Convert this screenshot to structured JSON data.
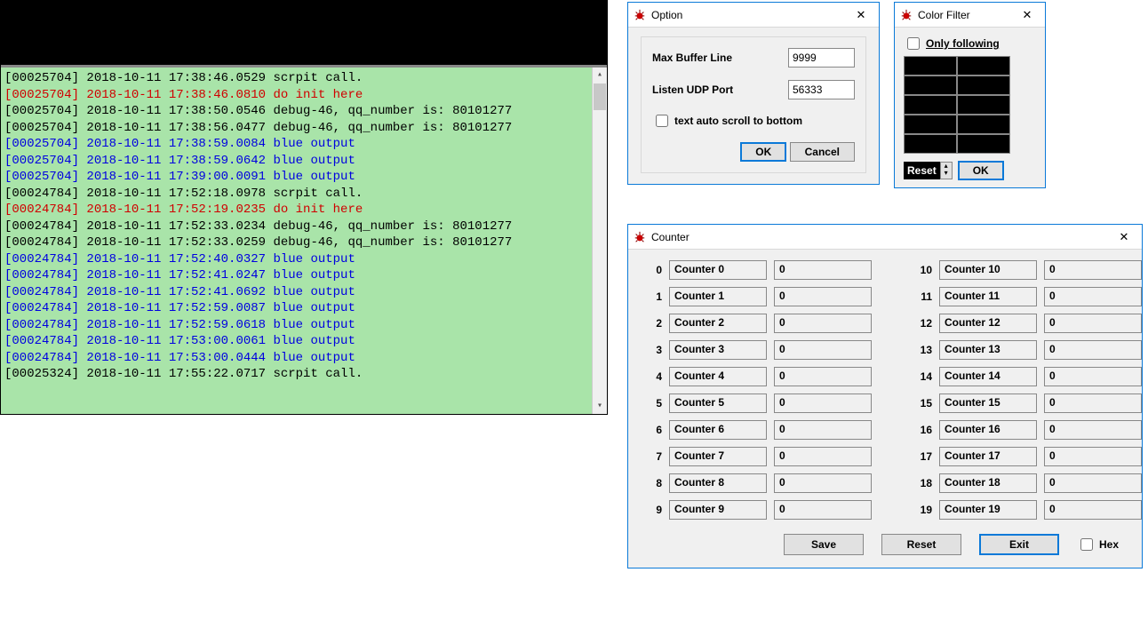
{
  "log": {
    "lines": [
      {
        "pid": "[00025704]",
        "ts": "2018-10-11 17:38:46.0529",
        "msg": "scrpit call.",
        "cls": "black"
      },
      {
        "pid": "[00025704]",
        "ts": "2018-10-11 17:38:46.0810",
        "msg": "do init here",
        "cls": "red"
      },
      {
        "pid": "[00025704]",
        "ts": "2018-10-11 17:38:50.0546",
        "msg": "debug-46, qq_number is: 80101277",
        "cls": "black"
      },
      {
        "pid": "[00025704]",
        "ts": "2018-10-11 17:38:56.0477",
        "msg": "debug-46, qq_number is: 80101277",
        "cls": "black"
      },
      {
        "pid": "[00025704]",
        "ts": "2018-10-11 17:38:59.0084",
        "msg": "blue output",
        "cls": "blue"
      },
      {
        "pid": "[00025704]",
        "ts": "2018-10-11 17:38:59.0642",
        "msg": "blue output",
        "cls": "blue"
      },
      {
        "pid": "[00025704]",
        "ts": "2018-10-11 17:39:00.0091",
        "msg": "blue output",
        "cls": "blue"
      },
      {
        "pid": "[00024784]",
        "ts": "2018-10-11 17:52:18.0978",
        "msg": "scrpit call.",
        "cls": "black"
      },
      {
        "pid": "[00024784]",
        "ts": "2018-10-11 17:52:19.0235",
        "msg": "do init here",
        "cls": "red"
      },
      {
        "pid": "[00024784]",
        "ts": "2018-10-11 17:52:33.0234",
        "msg": "debug-46, qq_number is: 80101277",
        "cls": "black"
      },
      {
        "pid": "[00024784]",
        "ts": "2018-10-11 17:52:33.0259",
        "msg": "debug-46, qq_number is: 80101277",
        "cls": "black"
      },
      {
        "pid": "[00024784]",
        "ts": "2018-10-11 17:52:40.0327",
        "msg": "blue output",
        "cls": "blue"
      },
      {
        "pid": "[00024784]",
        "ts": "2018-10-11 17:52:41.0247",
        "msg": "blue output",
        "cls": "blue"
      },
      {
        "pid": "[00024784]",
        "ts": "2018-10-11 17:52:41.0692",
        "msg": "blue output",
        "cls": "blue"
      },
      {
        "pid": "[00024784]",
        "ts": "2018-10-11 17:52:59.0087",
        "msg": "blue output",
        "cls": "blue"
      },
      {
        "pid": "[00024784]",
        "ts": "2018-10-11 17:52:59.0618",
        "msg": "blue output",
        "cls": "blue"
      },
      {
        "pid": "[00024784]",
        "ts": "2018-10-11 17:53:00.0061",
        "msg": "blue output",
        "cls": "blue"
      },
      {
        "pid": "[00024784]",
        "ts": "2018-10-11 17:53:00.0444",
        "msg": "blue output",
        "cls": "blue"
      },
      {
        "pid": "[00025324]",
        "ts": "2018-10-11 17:55:22.0717",
        "msg": "scrpit call.",
        "cls": "black"
      }
    ]
  },
  "option": {
    "title": "Option",
    "max_buffer_label": "Max Buffer Line",
    "max_buffer_value": "9999",
    "port_label": "Listen UDP Port",
    "port_value": "56333",
    "autoscroll_label": "text auto scroll to bottom",
    "ok": "OK",
    "cancel": "Cancel"
  },
  "filter": {
    "title": "Color Filter",
    "only_label": "Only following",
    "reset": "Reset",
    "ok": "OK"
  },
  "counter": {
    "title": "Counter",
    "save": "Save",
    "reset": "Reset",
    "exit": "Exit",
    "hex": "Hex",
    "items": [
      {
        "idx": "0",
        "name": "Counter 0",
        "val": "0"
      },
      {
        "idx": "1",
        "name": "Counter 1",
        "val": "0"
      },
      {
        "idx": "2",
        "name": "Counter 2",
        "val": "0"
      },
      {
        "idx": "3",
        "name": "Counter 3",
        "val": "0"
      },
      {
        "idx": "4",
        "name": "Counter 4",
        "val": "0"
      },
      {
        "idx": "5",
        "name": "Counter 5",
        "val": "0"
      },
      {
        "idx": "6",
        "name": "Counter 6",
        "val": "0"
      },
      {
        "idx": "7",
        "name": "Counter 7",
        "val": "0"
      },
      {
        "idx": "8",
        "name": "Counter 8",
        "val": "0"
      },
      {
        "idx": "9",
        "name": "Counter 9",
        "val": "0"
      },
      {
        "idx": "10",
        "name": "Counter 10",
        "val": "0"
      },
      {
        "idx": "11",
        "name": "Counter 11",
        "val": "0"
      },
      {
        "idx": "12",
        "name": "Counter 12",
        "val": "0"
      },
      {
        "idx": "13",
        "name": "Counter 13",
        "val": "0"
      },
      {
        "idx": "14",
        "name": "Counter 14",
        "val": "0"
      },
      {
        "idx": "15",
        "name": "Counter 15",
        "val": "0"
      },
      {
        "idx": "16",
        "name": "Counter 16",
        "val": "0"
      },
      {
        "idx": "17",
        "name": "Counter 17",
        "val": "0"
      },
      {
        "idx": "18",
        "name": "Counter 18",
        "val": "0"
      },
      {
        "idx": "19",
        "name": "Counter 19",
        "val": "0"
      }
    ]
  }
}
